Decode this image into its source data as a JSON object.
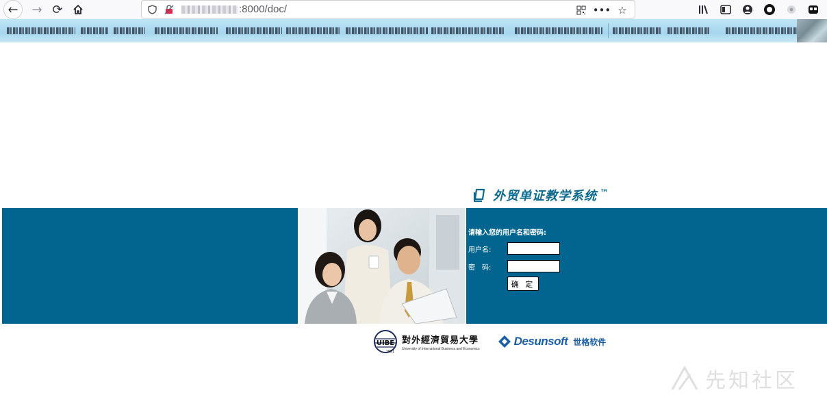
{
  "browser": {
    "address_visible": ":8000/doc/"
  },
  "page": {
    "system_title": "外贸单证教学系统",
    "trademark": "™",
    "login": {
      "prompt": "请输入您的用户名和密码:",
      "username_label": "用户名:",
      "password_label": "密　码:",
      "username_value": "",
      "password_value": "",
      "submit_label": "确 定"
    },
    "logos": {
      "uibe_cn": "對外經濟貿易大學",
      "uibe_en": "University of International Business and Economics",
      "uibe_year": "1951",
      "uibe_mark": "UIBE",
      "desunsoft_name": "Desunsoft",
      "desunsoft_cn": "世格软件"
    },
    "watermark": "先知社区"
  },
  "colors": {
    "band": "#01658f",
    "title": "#0d6a8e",
    "desunsoft": "#1a5ea8"
  }
}
